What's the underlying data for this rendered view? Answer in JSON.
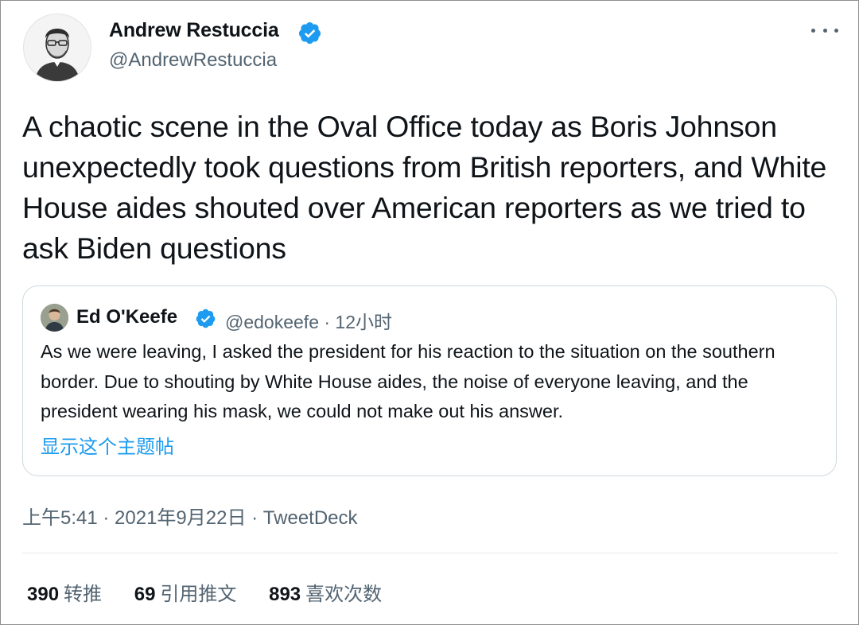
{
  "author": {
    "name": "Andrew Restuccia",
    "handle": "@AndrewRestuccia"
  },
  "tweet": {
    "text": "A chaotic scene in the Oval Office today as Boris Johnson unexpectedly took questions from British reporters, and White House aides shouted over American reporters as we tried to ask Biden questions"
  },
  "quote": {
    "name": "Ed O'Keefe",
    "meta": "@edokeefe · 12小时",
    "text": "As we were leaving, I asked the president for his reaction to the situation on the southern border. Due to shouting by White House aides, the noise of everyone leaving, and the president wearing his mask, we could not make out his answer.",
    "show_thread": "显示这个主题帖"
  },
  "meta": "上午5:41 · 2021年9月22日 · TweetDeck",
  "stats": {
    "retweets": {
      "count": "390",
      "label": "转推"
    },
    "quotes": {
      "count": "69",
      "label": "引用推文"
    },
    "likes": {
      "count": "893",
      "label": "喜欢次数"
    }
  },
  "colors": {
    "text": "#0f1419",
    "secondary": "#536471",
    "accent": "#1d9bf0",
    "border": "#cfd9de"
  },
  "icons": [
    "avatar",
    "verified-badge-icon",
    "more-icon"
  ]
}
